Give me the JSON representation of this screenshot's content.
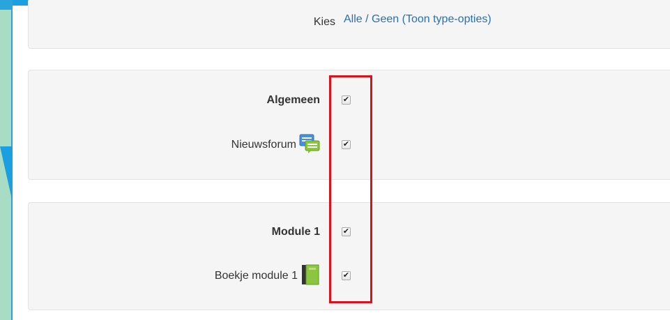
{
  "select": {
    "label": "Kies",
    "all_label": "Alle",
    "separator": "/",
    "none_label": "Geen",
    "type_options_label": "(Toon type-opties)"
  },
  "sections": [
    {
      "title": "Algemeen",
      "checked": true,
      "items": [
        {
          "label": "Nieuwsforum",
          "icon": "forum-icon",
          "checked": true
        }
      ]
    },
    {
      "title": "Module 1",
      "checked": true,
      "items": [
        {
          "label": "Boekje module 1",
          "icon": "book-icon",
          "checked": true
        }
      ]
    }
  ],
  "checkmark": "✔",
  "colors": {
    "background": "#1a9fe0",
    "panel": "#f5f5f5",
    "link": "#2a6fb0",
    "highlight": "#d9121c"
  }
}
